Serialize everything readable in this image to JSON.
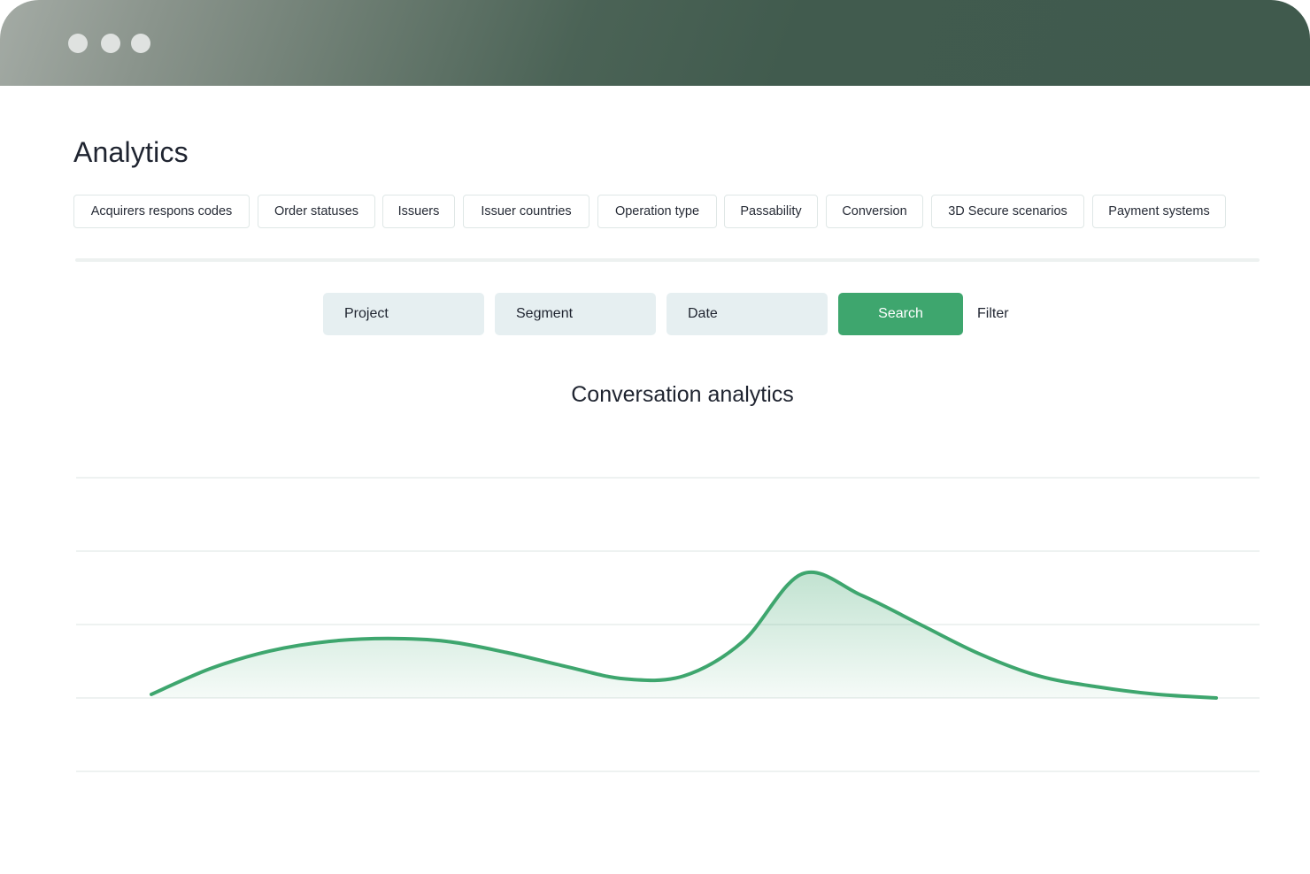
{
  "window": {
    "controls": [
      "window-dot",
      "window-dot",
      "window-dot"
    ],
    "titlebar_colors": [
      "#a4aba5",
      "#405a4d"
    ]
  },
  "page": {
    "title": "Analytics"
  },
  "tabs": [
    {
      "label": "Acquirers respons codes"
    },
    {
      "label": "Order statuses"
    },
    {
      "label": "Issuers"
    },
    {
      "label": "Issuer countries"
    },
    {
      "label": "Operation type"
    },
    {
      "label": "Passability"
    },
    {
      "label": "Conversion"
    },
    {
      "label": "3D Secure  scenarios"
    },
    {
      "label": "Payment systems"
    }
  ],
  "filters": {
    "project_label": "Project",
    "segment_label": "Segment",
    "date_label": "Date",
    "search_label": "Search",
    "filter_label": "Filter"
  },
  "colors": {
    "accent": "#3ea66e",
    "field_bg": "#e6eff1",
    "text": "#1f2430"
  },
  "chart_data": {
    "type": "area",
    "title": "Conversation analytics",
    "xlabel": "",
    "ylabel": "",
    "grid": true,
    "gridlines": 5,
    "ylim": [
      0,
      4
    ],
    "x": [
      0,
      1,
      2,
      3,
      4,
      5,
      6,
      7,
      8,
      9,
      10,
      11,
      12,
      13,
      14,
      15,
      16,
      17,
      18
    ],
    "series": [
      {
        "values": [
          1.05,
          1.4,
          1.64,
          1.77,
          1.81,
          1.77,
          1.62,
          1.43,
          1.26,
          1.3,
          1.77,
          2.69,
          2.4,
          2.0,
          1.6,
          1.3,
          1.15,
          1.05,
          1.0
        ]
      }
    ]
  }
}
